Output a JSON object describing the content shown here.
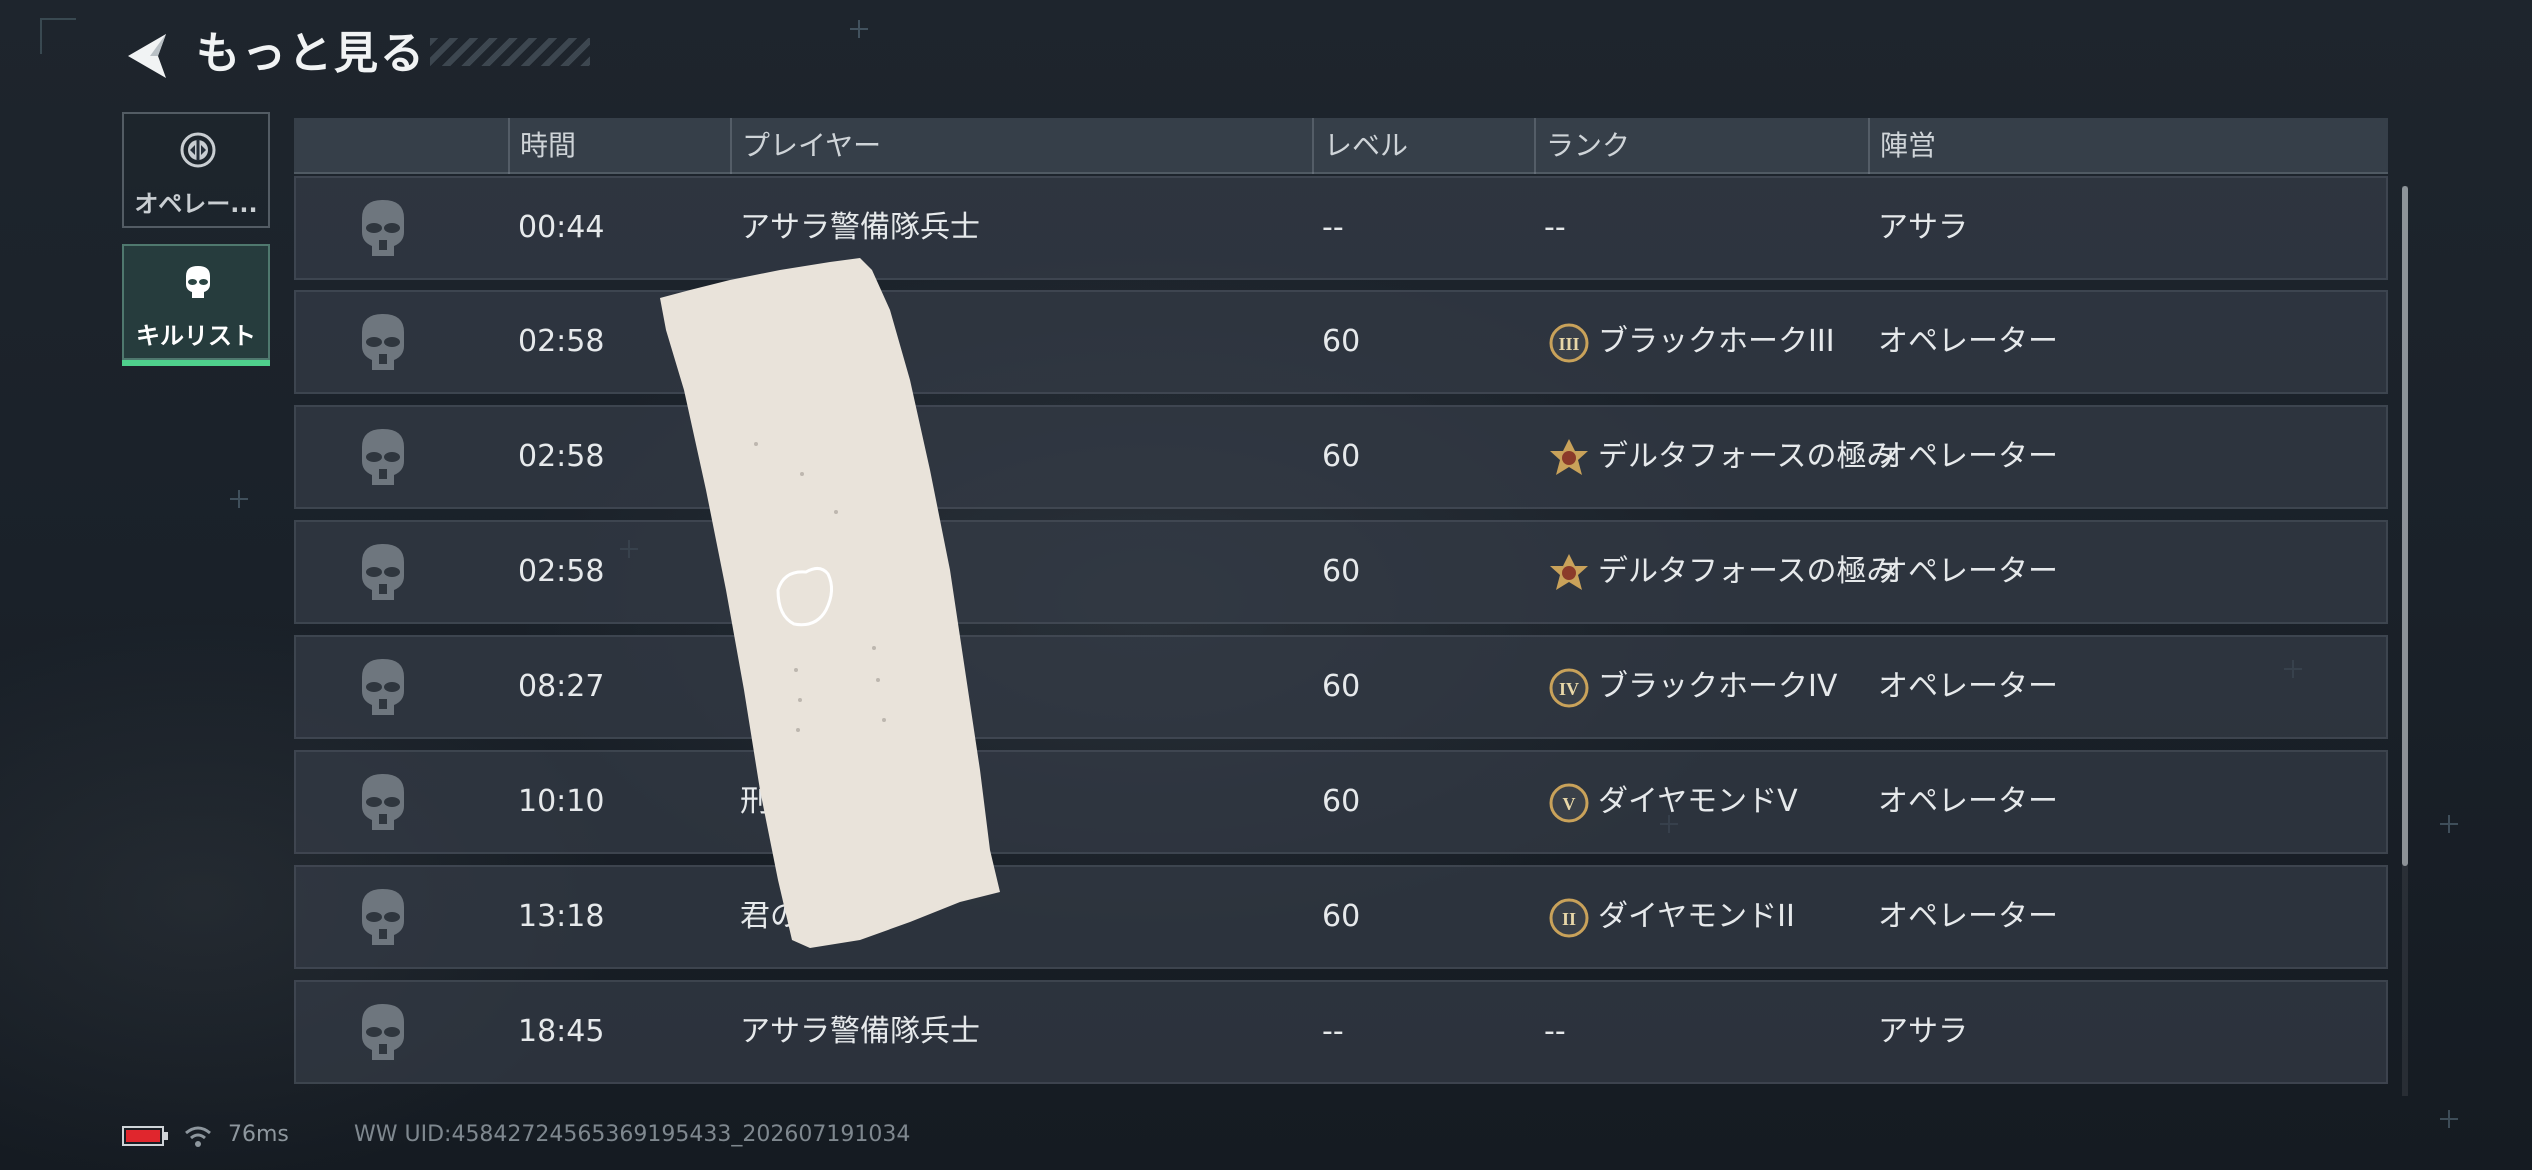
{
  "header": {
    "title": "もっと見る",
    "back_icon": "back-arrow-icon"
  },
  "sidebar": {
    "tabs": [
      {
        "label": "オペレー...",
        "icon": "operator-icon",
        "active": false
      },
      {
        "label": "キルリスト",
        "icon": "skull-mask-icon",
        "active": true
      }
    ]
  },
  "table": {
    "columns": [
      "",
      "時間",
      "プレイヤー",
      "レベル",
      "ランク",
      "陣営"
    ],
    "rows": [
      {
        "time": "00:44",
        "player": "アサラ警備隊兵士",
        "level": "--",
        "rank": "--",
        "rank_icon": "",
        "faction": "アサラ"
      },
      {
        "time": "02:58",
        "player": "£®",
        "level": "60",
        "rank": "ブラックホークIII",
        "rank_icon": "III",
        "faction": "オペレーター"
      },
      {
        "time": "02:58",
        "player": "",
        "level": "60",
        "rank": "デルタフォースの極み",
        "rank_icon": "delta",
        "faction": "オペレーター"
      },
      {
        "time": "02:58",
        "player": "",
        "level": "60",
        "rank": "デルタフォースの極み",
        "rank_icon": "delta",
        "faction": "オペレーター"
      },
      {
        "time": "08:27",
        "player": "",
        "level": "60",
        "rank": "ブラックホークIV",
        "rank_icon": "IV",
        "faction": "オペレーター"
      },
      {
        "time": "10:10",
        "player": "刑",
        "level": "60",
        "rank": "ダイヤモンドV",
        "rank_icon": "V",
        "faction": "オペレーター"
      },
      {
        "time": "13:18",
        "player": "君の",
        "level": "60",
        "rank": "ダイヤモンドII",
        "rank_icon": "II",
        "faction": "オペレーター"
      },
      {
        "time": "18:45",
        "player": "アサラ警備隊兵士",
        "level": "--",
        "rank": "--",
        "rank_icon": "",
        "faction": "アサラ"
      }
    ]
  },
  "footer": {
    "ping": "76ms",
    "uid": "WW UID:45842724565369195433_202607191034",
    "battery_color": "#e0262d"
  },
  "colors": {
    "accent": "#4fd08c",
    "rank_gold": "#c9a25a"
  }
}
